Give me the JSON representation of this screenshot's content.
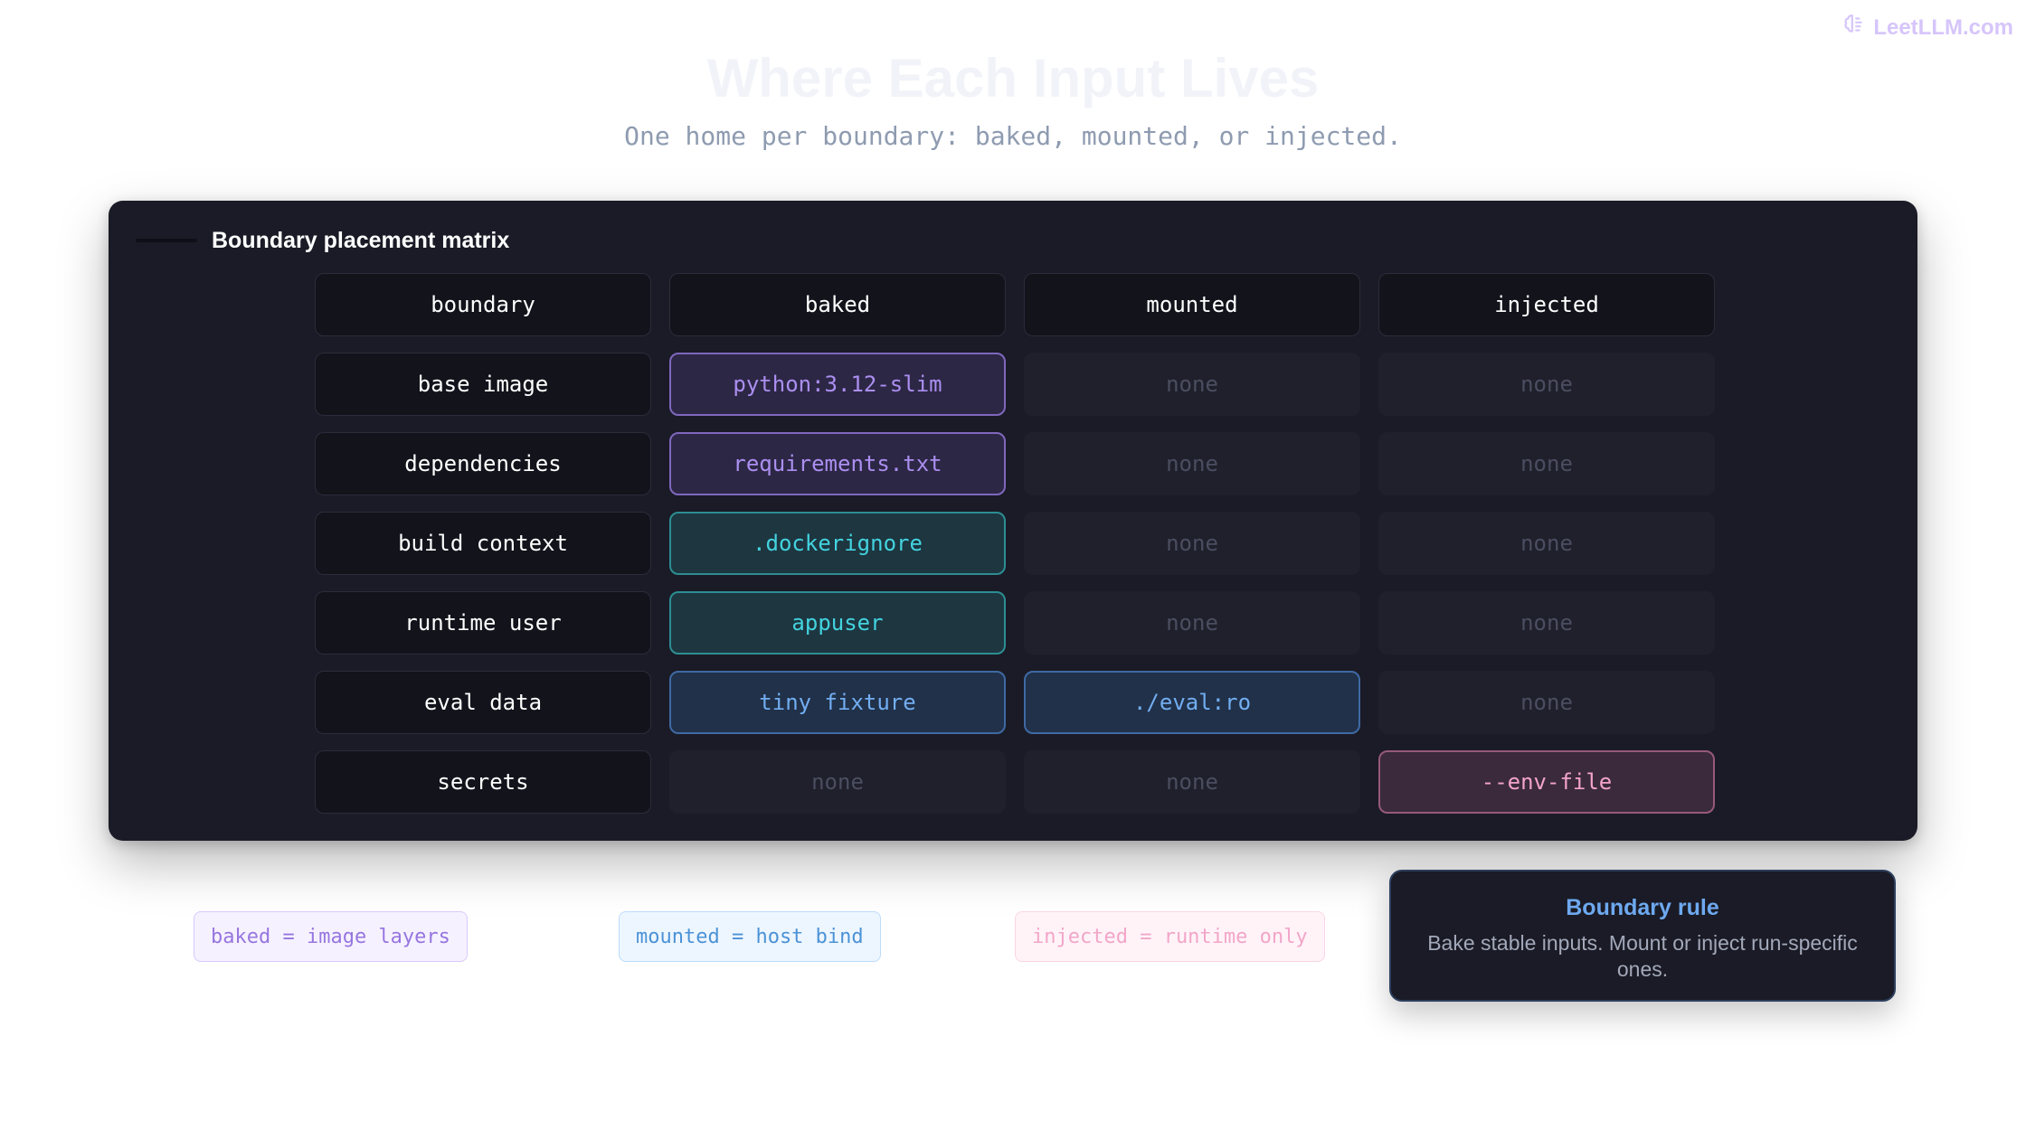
{
  "brand": {
    "text": "LeetLLM.com",
    "icon": "brain-icon",
    "color": "#d6c5fb"
  },
  "header": {
    "title": "Where Each Input Lives",
    "subtitle": "One home per boundary: baked, mounted, or injected."
  },
  "panel": {
    "title": "Boundary placement matrix",
    "columns": [
      "boundary",
      "baked",
      "mounted",
      "injected"
    ],
    "rows": [
      {
        "boundary": "base image",
        "baked": "python:3.12-slim",
        "mounted": "none",
        "injected": "none"
      },
      {
        "boundary": "dependencies",
        "baked": "requirements.txt",
        "mounted": "none",
        "injected": "none"
      },
      {
        "boundary": "build context",
        "baked": ".dockerignore",
        "mounted": "none",
        "injected": "none"
      },
      {
        "boundary": "runtime user",
        "baked": "appuser",
        "mounted": "none",
        "injected": "none"
      },
      {
        "boundary": "eval data",
        "baked": "tiny fixture",
        "mounted": "./eval:ro",
        "injected": "none"
      },
      {
        "boundary": "secrets",
        "baked": "none",
        "mounted": "none",
        "injected": "--env-file"
      }
    ]
  },
  "legend": {
    "baked": "baked = image layers",
    "mounted": "mounted = host bind",
    "injected": "injected = runtime only"
  },
  "rule": {
    "title": "Boundary rule",
    "text": "Bake stable inputs. Mount or inject run-specific ones."
  },
  "colors": {
    "panel_bg": "#1a1b26",
    "baked_accent": "#ab8ff0",
    "teal_accent": "#43d3df",
    "mounted_accent": "#72aef2",
    "injected_accent": "#f3a3ca",
    "muted_none": "#4b4e60"
  }
}
